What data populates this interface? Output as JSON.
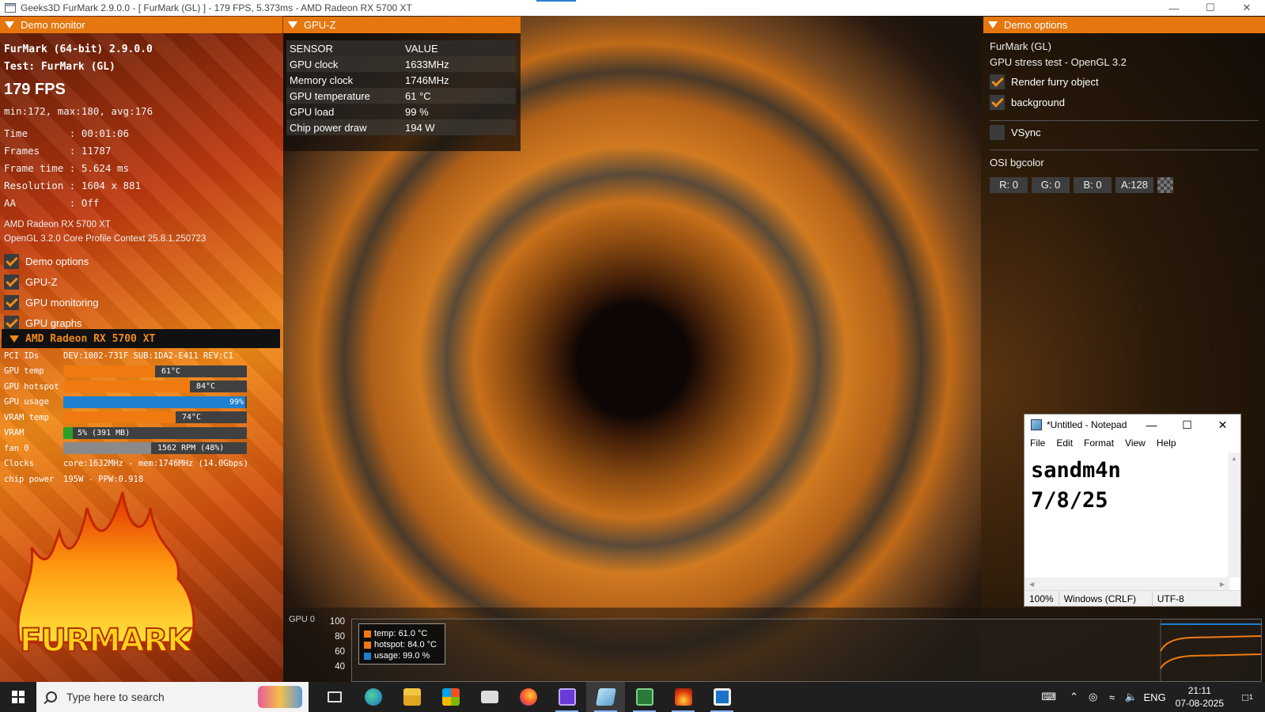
{
  "window": {
    "title": "Geeks3D FurMark 2.9.0.0 - [ FurMark (GL) ] - 179 FPS, 5.373ms - AMD Radeon RX 5700 XT"
  },
  "monitor": {
    "header": "Demo monitor",
    "line1": "FurMark (64-bit) 2.9.0.0",
    "line2": "Test: FurMark (GL)",
    "fps": "179 FPS",
    "minmax": "min:172, max:180, avg:176",
    "rows": [
      "Time       : 00:01:06",
      "Frames     : 11787",
      "Frame time : 5.624 ms",
      "Resolution : 1604 x 881",
      "AA         : Off"
    ],
    "gpu_name": "AMD Radeon RX 5700 XT",
    "gl_context": "OpenGL 3.2.0 Core Profile Context 25.8.1.250723",
    "checks": [
      "Demo options",
      "GPU-Z",
      "GPU monitoring",
      "GPU graphs"
    ]
  },
  "gpu_panel": {
    "title": "AMD Radeon RX 5700 XT",
    "pci_label": "PCI IDs",
    "pci_value": "DEV:1002-731F SUB:1DA2-E411 REV:C1",
    "bars": [
      {
        "label": "GPU temp",
        "text": "61°C",
        "fraction": 0.5,
        "color": "#f07a10"
      },
      {
        "label": "GPU hotspot",
        "text": "84°C",
        "fraction": 0.69,
        "color": "#f07a10"
      },
      {
        "label": "GPU usage",
        "text": "99%",
        "fraction": 0.99,
        "color": "#1f7fd0"
      },
      {
        "label": "VRAM temp",
        "text": "74°C",
        "fraction": 0.61,
        "color": "#f07a10"
      },
      {
        "label": "VRAM",
        "text": "5% (391 MB)",
        "fraction": 0.05,
        "color": "#2aa02a"
      },
      {
        "label": "fan 0",
        "text": "1562 RPM (48%)",
        "fraction": 0.48,
        "color": "#8a8a8a"
      }
    ],
    "clocks_label": "Clocks",
    "clocks_value": "core:1632MHz - mem:1746MHz (14.0Gbps)",
    "power_label": "chip power",
    "power_value": "195W - PPW:0.918"
  },
  "logo_text": "FURMARK",
  "gpuz": {
    "header": "GPU-Z",
    "col_sensor": "SENSOR",
    "col_value": "VALUE",
    "rows": [
      {
        "sensor": "GPU clock",
        "value": "1633MHz"
      },
      {
        "sensor": "Memory clock",
        "value": "1746MHz"
      },
      {
        "sensor": "GPU temperature",
        "value": "61 °C"
      },
      {
        "sensor": "GPU load",
        "value": "99 %"
      },
      {
        "sensor": "Chip power draw",
        "value": "194 W"
      }
    ]
  },
  "options": {
    "header": "Demo options",
    "line1": "FurMark (GL)",
    "line2": "GPU stress test - OpenGL 3.2",
    "render_furry": "Render furry object",
    "background": "background",
    "vsync": "VSync",
    "osi_label": "OSI bgcolor",
    "r": "R: 0",
    "g": "G: 0",
    "b": "B: 0",
    "a": "A:128"
  },
  "graph": {
    "title": "GPU 0",
    "y_labels": [
      "100",
      "80",
      "60",
      "40"
    ],
    "legend": [
      {
        "text": "temp: 61.0 °C",
        "color": "#f07a10"
      },
      {
        "text": "hotspot: 84.0 °C",
        "color": "#f07a10"
      },
      {
        "text": "usage: 99.0 %",
        "color": "#1f7fd0"
      }
    ]
  },
  "notepad": {
    "title": "*Untitled - Notepad",
    "menu": [
      "File",
      "Edit",
      "Format",
      "View",
      "Help"
    ],
    "text": "sandm4n\n7/8/25",
    "zoom": "100%",
    "eol": "Windows (CRLF)",
    "encoding": "UTF-8"
  },
  "taskbar": {
    "search_placeholder": "Type here to search",
    "lang": "ENG",
    "time": "21:11",
    "date": "07-08-2025",
    "notif_count": "1"
  }
}
